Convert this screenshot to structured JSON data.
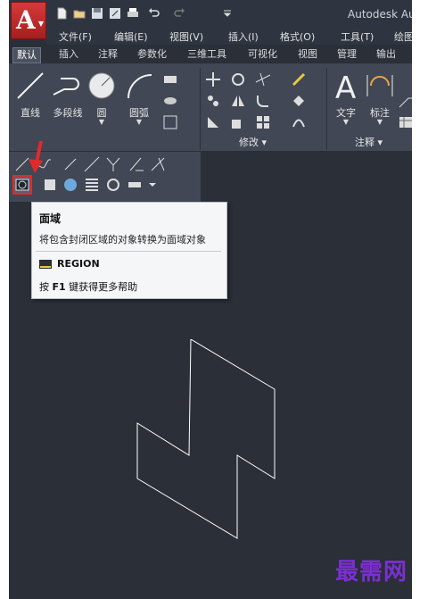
{
  "app": {
    "title": "Autodesk Au",
    "logo_letter": "A"
  },
  "menubar": {
    "items": [
      "文件(F)",
      "编辑(E)",
      "视图(V)",
      "插入(I)",
      "格式(O)",
      "工具(T)",
      "绘图"
    ]
  },
  "tabs": [
    "默认",
    "插入",
    "注释",
    "参数化",
    "三维工具",
    "可视化",
    "视图",
    "管理",
    "输出"
  ],
  "ribbon": {
    "draw": [
      "直线",
      "多段线",
      "圆",
      "圆弧"
    ],
    "annotate": [
      "文字",
      "标注"
    ],
    "panels": {
      "modify": "修改 ▾",
      "annotation": "注释 ▾"
    }
  },
  "tooltip": {
    "title": "面域",
    "description": "将包含封闭区域的对象转换为面域对象",
    "command": "REGION",
    "help_prefix": "按",
    "help_key": "F1",
    "help_suffix": "键获得更多帮助"
  },
  "watermark": "最需网",
  "colors": {
    "accent": "#e22a2a",
    "canvas": "#2a2f38",
    "ribbon": "#414754",
    "watermark": "#7b2fd1"
  }
}
